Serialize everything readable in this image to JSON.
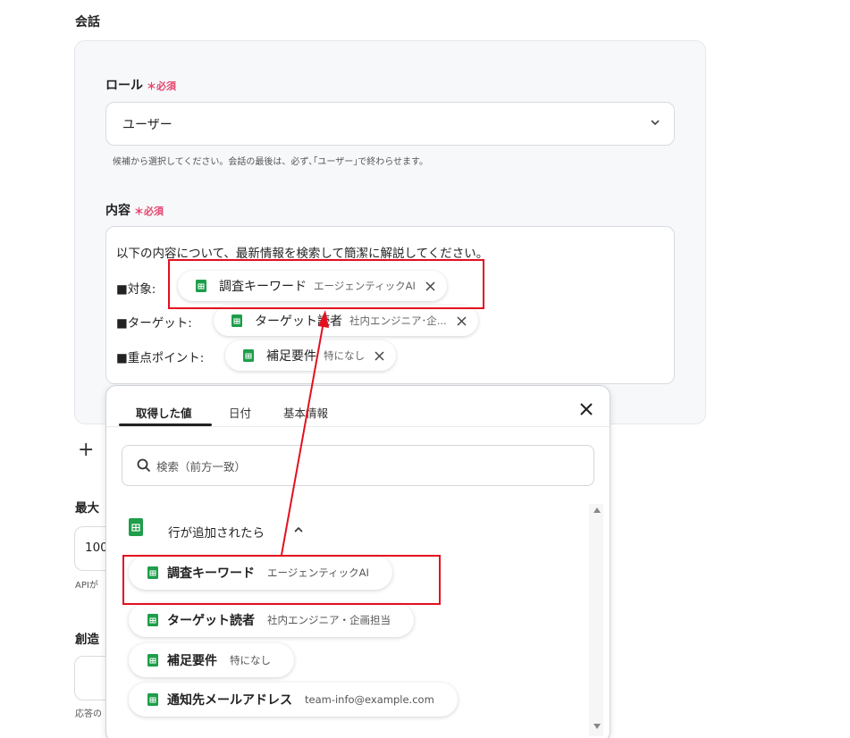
{
  "section": {
    "title": "会話"
  },
  "role": {
    "label": "ロール",
    "required": "＊必須",
    "value": "ユーザー",
    "help": "候補から選択してください。会話の最後は、必ず､｢ユーザー｣で終わらせます。"
  },
  "content": {
    "label": "内容",
    "required": "＊必須",
    "line1": "以下の内容について、最新情報を検索して簡潔に解説してください。",
    "rows": [
      {
        "prefix": "■対象:",
        "chip_name": "調査キーワード",
        "chip_value": "エージェンティックAI"
      },
      {
        "prefix": "■ターゲット:",
        "chip_name": "ターゲット読者",
        "chip_value": "社内エンジニア･企..."
      },
      {
        "prefix": "■重点ポイント:",
        "chip_name": "補足要件",
        "chip_value": "特になし"
      }
    ]
  },
  "add_button": {
    "label": "+"
  },
  "truncated": {
    "max_label": "最大",
    "max_value": "100",
    "api_help": "APIが",
    "creative_label": "創造",
    "response_help": "応答の"
  },
  "popup": {
    "tabs": [
      {
        "label": "取得した値",
        "active": true
      },
      {
        "label": "日付",
        "active": false
      },
      {
        "label": "基本情報",
        "active": false
      }
    ],
    "search_placeholder": "検索（前方一致）",
    "group_title": "行が追加されたら",
    "items": [
      {
        "name": "調査キーワード",
        "value": "エージェンティックAI"
      },
      {
        "name": "ターゲット読者",
        "value": "社内エンジニア・企画担当"
      },
      {
        "name": "補足要件",
        "value": "特になし"
      },
      {
        "name": "通知先メールアドレス",
        "value": "team-info@example.com"
      }
    ]
  },
  "colors": {
    "sheets_green": "#1e9e4a",
    "required_pink": "#e5446d",
    "annotation_red": "#e3101f"
  },
  "icons": [
    "sheets-icon",
    "chevron-down-icon",
    "chevron-up-icon",
    "close-icon",
    "search-icon",
    "plus-icon"
  ]
}
